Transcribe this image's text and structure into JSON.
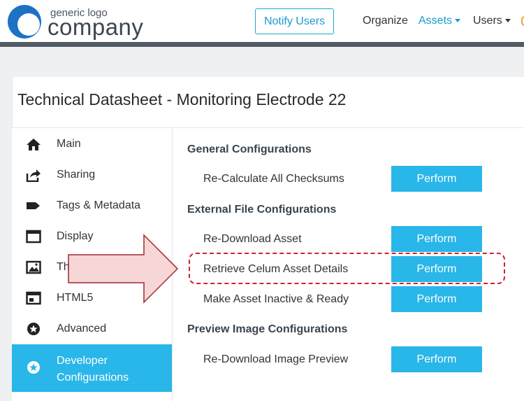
{
  "header": {
    "logo_top": "generic logo",
    "logo_bottom": "company",
    "notify_button": "Notify Users",
    "nav": {
      "organize": "Organize",
      "assets": "Assets",
      "users": "Users"
    }
  },
  "page": {
    "title": "Technical Datasheet - Monitoring Electrode 22"
  },
  "sidebar": {
    "items": [
      {
        "label": "Main",
        "icon": "home-icon"
      },
      {
        "label": "Sharing",
        "icon": "share-icon"
      },
      {
        "label": "Tags & Metadata",
        "icon": "tag-icon"
      },
      {
        "label": "Display",
        "icon": "window-icon"
      },
      {
        "label": "Th",
        "icon": "image-icon"
      },
      {
        "label": "HTML5",
        "icon": "html5-icon"
      },
      {
        "label": "Advanced",
        "icon": "star-icon"
      },
      {
        "label": "Developer Configurations",
        "label_line1": "Developer",
        "label_line2": "Configurations",
        "icon": "star-circle-icon",
        "active": true
      }
    ]
  },
  "main": {
    "sections": [
      {
        "heading": "General Configurations",
        "rows": [
          {
            "label": "Re-Calculate All Checksums",
            "action": "Perform"
          }
        ]
      },
      {
        "heading": "External File Configurations",
        "rows": [
          {
            "label": "Re-Download Asset",
            "action": "Perform"
          },
          {
            "label": "Retrieve Celum Asset Details",
            "action": "Perform"
          },
          {
            "label": "Make Asset Inactive & Ready",
            "action": "Perform"
          }
        ]
      },
      {
        "heading": "Preview Image Configurations",
        "rows": [
          {
            "label": "Re-Download Image Preview",
            "action": "Perform"
          }
        ]
      }
    ]
  },
  "colors": {
    "accent": "#29b6e8",
    "header_border": "#525b66",
    "highlight": "#d0212b",
    "arrow_fill": "#f5d3d3",
    "arrow_stroke": "#a3282d"
  }
}
